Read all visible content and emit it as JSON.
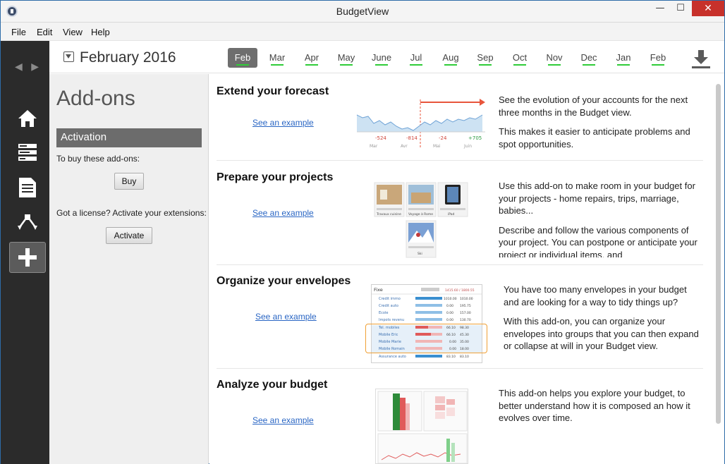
{
  "window": {
    "title": "BudgetView",
    "controls": {
      "minimize": "—",
      "maximize": "☐",
      "close": "✕"
    }
  },
  "menu": [
    "File",
    "Edit",
    "View",
    "Help"
  ],
  "sidebar": {
    "nav_arrows": "◀ ▶",
    "items": [
      {
        "name": "home-icon",
        "active": false
      },
      {
        "name": "accounts-icon",
        "active": false
      },
      {
        "name": "document-icon",
        "active": false
      },
      {
        "name": "categorize-icon",
        "active": false
      },
      {
        "name": "add-icon",
        "active": true
      }
    ]
  },
  "header": {
    "current_month": "February 2016",
    "months": [
      "Feb",
      "Mar",
      "Apr",
      "May",
      "June",
      "Jul",
      "Aug",
      "Sep",
      "Oct",
      "Nov",
      "Dec",
      "Jan",
      "Feb"
    ],
    "active_month_index": 0
  },
  "addons_panel": {
    "title": "Add-ons",
    "activation_header": "Activation",
    "buy_text": "To buy these add-ons:",
    "buy_button": "Buy",
    "license_text": "Got a license? Activate your extensions:",
    "activate_button": "Activate"
  },
  "sections": [
    {
      "title": "Extend your forecast",
      "link": "See an example",
      "paragraphs": [
        "See the evolution of your accounts for the next three months in the Budget view.",
        "This makes it easier to anticipate problems and spot opportunities."
      ],
      "chart_labels": [
        "Mar",
        "Avr",
        "Mai",
        "Juin"
      ],
      "chart_values": [
        "-524",
        "-814",
        "-24",
        "+705"
      ]
    },
    {
      "title": "Prepare your projects",
      "link": "See an example",
      "paragraphs": [
        "Use this add-on to make room in your budget for your projects - home repairs, trips, marriage, babies...",
        "Describe and follow the various components of your project. You can postpone or anticipate your project or individual items, and"
      ],
      "project_labels": [
        "Travaux cuisine",
        "Voyage à Rome",
        "iPad",
        "Ski"
      ]
    },
    {
      "title": "Organize your envelopes",
      "link": "See an example",
      "paragraphs": [
        "You have too many envelopes in your budget and are looking for a way to tidy things up?",
        "With this add-on, you can organize your envelopes into groups that you can then expand or collapse at will in your Budget view."
      ],
      "envelope_group": "Fixe",
      "envelope_group_values": "1415.60 / 1800.55",
      "envelopes": [
        {
          "label": "Credit immo",
          "a": "1010.00",
          "b": "1010.00"
        },
        {
          "label": "Credit auto",
          "a": "0.00",
          "b": "195.75"
        },
        {
          "label": "Ecole",
          "a": "0.00",
          "b": "157.00"
        },
        {
          "label": "Impots revenu",
          "a": "0.00",
          "b": "130.70"
        },
        {
          "label": "Tel. mobiles",
          "a": "66.10",
          "b": "98.30"
        },
        {
          "label": "Mobile Eric",
          "a": "66.10",
          "b": "45.30"
        },
        {
          "label": "Mobile Marie",
          "a": "0.00",
          "b": "35.00"
        },
        {
          "label": "Mobile Romain",
          "a": "0.00",
          "b": "18.00"
        },
        {
          "label": "Assurance auto",
          "a": "83.10",
          "b": "83.10"
        }
      ]
    },
    {
      "title": "Analyze your budget",
      "link": "See an example",
      "paragraphs": [
        "This add-on helps you explore your budget, to better understand how it is composed an how it evolves over time."
      ]
    }
  ],
  "colors": {
    "accent_green": "#2fcc38",
    "link_blue": "#2a66c4",
    "sidebar_dark": "#2b2b2b",
    "forecast_red": "#e8553b",
    "highlight_orange": "#f0a035"
  }
}
